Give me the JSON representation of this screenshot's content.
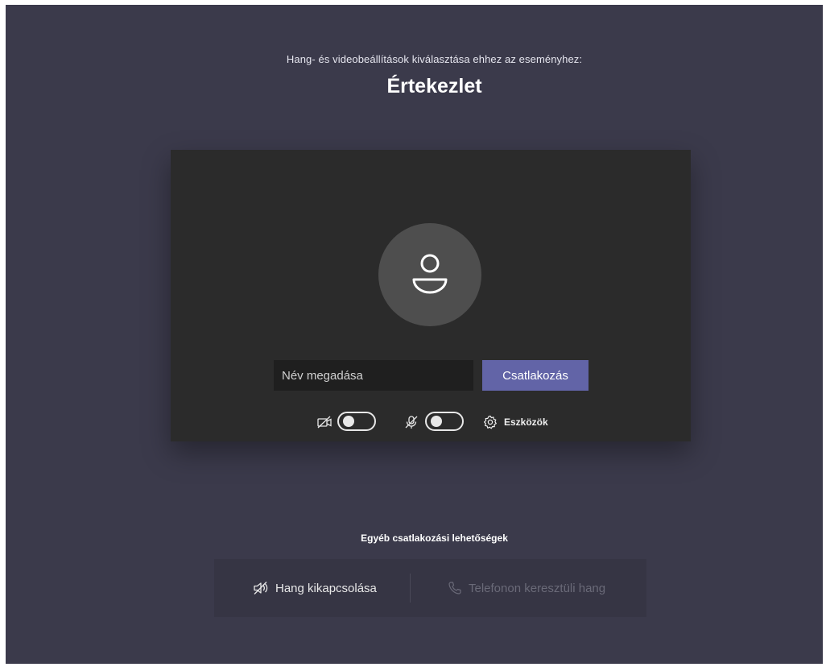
{
  "header": {
    "subtitle": "Hang- és videobeállítások kiválasztása ehhez az eseményhez:",
    "title": "Értekezlet"
  },
  "preview": {
    "avatar_icon": "person-icon",
    "name_input": {
      "placeholder": "Név megadása",
      "value": ""
    },
    "join_label": "Csatlakozás",
    "join_color": "#6264a7",
    "camera_toggle": {
      "icon": "camera-off-icon",
      "on": false
    },
    "mic_toggle": {
      "icon": "mic-off-icon",
      "on": false
    },
    "devices_icon": "gear-icon",
    "devices_label": "Eszközök"
  },
  "other_options": {
    "title": "Egyéb csatlakozási lehetőségek",
    "audio_off": {
      "icon": "speaker-off-icon",
      "label": "Hang kikapcsolása"
    },
    "phone_audio": {
      "icon": "phone-icon",
      "label": "Telefonon keresztüli hang",
      "enabled": false
    }
  },
  "colors": {
    "background": "#3b3a4b",
    "card": "#2b2b2b",
    "accent": "#6264a7"
  }
}
